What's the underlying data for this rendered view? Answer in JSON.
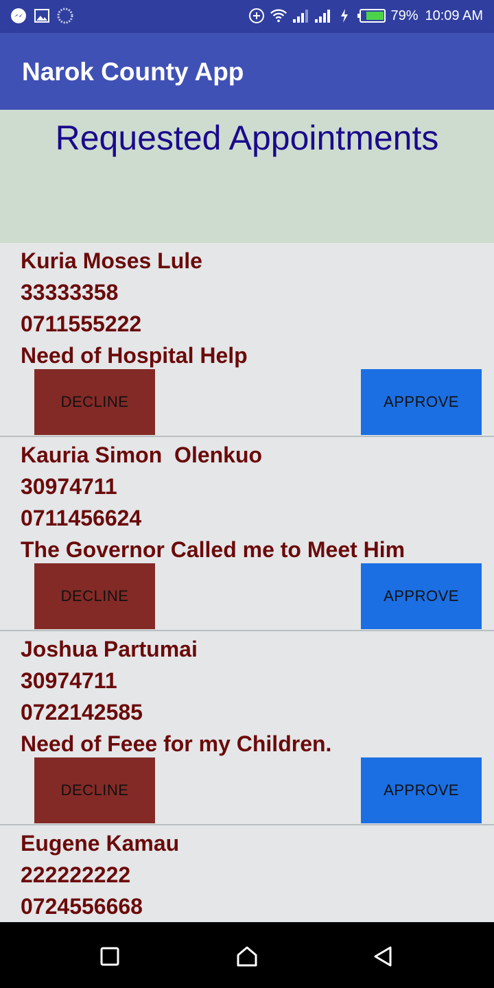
{
  "status_bar": {
    "battery_percent": "79%",
    "time": "10:09 AM",
    "icons": [
      "messenger-icon",
      "gallery-icon",
      "sync-icon",
      "data-saver-icon",
      "wifi-icon",
      "signal-icon",
      "signal-icon",
      "charging-icon",
      "battery-icon"
    ]
  },
  "app_bar": {
    "title": "Narok County App"
  },
  "header": {
    "title": "Requested Appointments"
  },
  "buttons": {
    "decline": "DECLINE",
    "approve": "APPROVE"
  },
  "appointments": [
    {
      "name": "Kuria Moses Lule",
      "id_number": "33333358",
      "phone": "0711555222",
      "reason": "Need of Hospital Help"
    },
    {
      "name": "Kauria Simon  Olenkuo",
      "id_number": "30974711",
      "phone": "0711456624",
      "reason": "The Governor Called me to Meet Him"
    },
    {
      "name": "Joshua Partumai",
      "id_number": "30974711",
      "phone": "0722142585",
      "reason": "Need of Feee for my Children."
    },
    {
      "name": "Eugene Kamau",
      "id_number": "222222222",
      "phone": "0724556668",
      "reason": ""
    }
  ],
  "colors": {
    "status_bar": "#303f9f",
    "app_bar": "#3f51b5",
    "header_bg": "#cddccf",
    "title_text": "#1a0a8c",
    "item_text": "#6b0a0a",
    "decline": "#832a26",
    "approve": "#1b6fe3"
  }
}
